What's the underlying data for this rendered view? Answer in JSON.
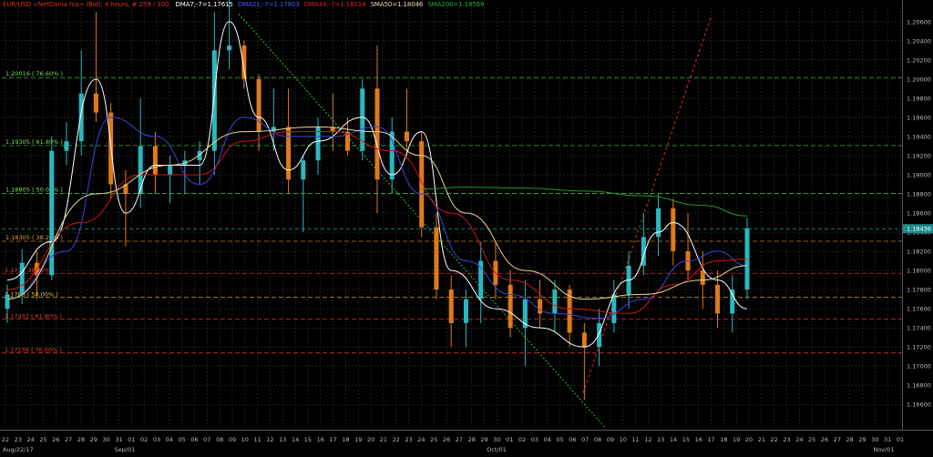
{
  "header": {
    "symbol": "EUR/USD <NetDania fxa> (Bid), 4 hours, # 259 / 300,",
    "dma7": "DMA7;-7=1.17615",
    "dma21": "DMA21;-7=1.17903",
    "dma34": "DMA34;-7=1.18114",
    "sma50": "SMA50=1.18046",
    "sma200": "SMA200=1.18569"
  },
  "colors": {
    "background": "#000000",
    "bull": "#2bb7c0",
    "bear": "#e07a17",
    "dma7": "#ffffff",
    "dma21": "#3a45d9",
    "dma34": "#d11414",
    "sma50": "#e8d49a",
    "sma200": "#1c9a2a",
    "fib_up": "#3fae3f",
    "fib_down": "#d42a2a",
    "fib_mid": "#c87818"
  },
  "chart_data": {
    "type": "candlestick",
    "title": "EUR/USD <NetDania fxa> (Bid), 4 hours",
    "ylim": [
      1.16336,
      1.2075
    ],
    "y_ticks": [
      1.206,
      1.204,
      1.202,
      1.2,
      1.198,
      1.196,
      1.194,
      1.192,
      1.19,
      1.188,
      1.186,
      1.184,
      1.182,
      1.18,
      1.178,
      1.176,
      1.174,
      1.172,
      1.17,
      1.168,
      1.166
    ],
    "y_tick_labels": [
      "1.20600",
      "1.20400",
      "1.20200",
      "1.20000",
      "1.19800",
      "1.19600",
      "1.19400",
      "1.19200",
      "1.19000",
      "1.18800",
      "1.18600",
      "1.18400",
      "1.18200",
      "1.18000",
      "1.17800",
      "1.17600",
      "1.17400",
      "1.17200",
      "1.17000",
      "1.16800",
      "1.16600"
    ],
    "last_price": "1.18436",
    "x_day_labels": [
      "22",
      "23",
      "24",
      "25",
      "26",
      "27",
      "28",
      "29",
      "30",
      "31",
      "01",
      "02",
      "03",
      "04",
      "05",
      "06",
      "07",
      "08",
      "09",
      "10",
      "11",
      "12",
      "13",
      "14",
      "15",
      "16",
      "17",
      "18",
      "19",
      "20",
      "21",
      "22",
      "23",
      "24",
      "25",
      "26",
      "27",
      "28",
      "29",
      "30",
      "01",
      "02",
      "03",
      "04",
      "05",
      "06",
      "07",
      "08",
      "09",
      "10",
      "11",
      "12",
      "13",
      "14",
      "15",
      "16",
      "17",
      "18",
      "19",
      "20",
      "21",
      "22",
      "23",
      "24",
      "25",
      "26",
      "27",
      "28",
      "29",
      "30",
      "31",
      "01"
    ],
    "x_month_labels": [
      "Aug/22/17",
      "Sep/01",
      "Oct/01",
      "Nov/01"
    ],
    "fib_levels_upper": [
      {
        "label": "1.20016 ( 76.60% )",
        "value": 1.20016
      },
      {
        "label": "1.19305 ( 61.80% )",
        "value": 1.19305
      },
      {
        "label": "1.18805 ( 50.00% )",
        "value": 1.18805
      },
      {
        "label": "1.18305 ( 38.20% )",
        "value": 1.18305
      }
    ],
    "fib_levels_lower": [
      {
        "label": "1.177 ( 38.20% )",
        "value": 1.1797
      },
      {
        "label": "1.1768 ( 50.00% )",
        "value": 1.1772
      },
      {
        "label": "1.17492 ( 61.80% )",
        "value": 1.17492
      },
      {
        "label": "1.17138 ( 76.60% )",
        "value": 1.17138
      }
    ],
    "extra_levels": [
      1.18436
    ],
    "trendlines": [
      {
        "name": "downtrend",
        "from": [
          "Aug 31",
          1.2068
        ],
        "to": [
          "Oct 09",
          1.1635
        ]
      },
      {
        "name": "projection",
        "from": [
          "Oct 06",
          1.167
        ],
        "to": [
          "Oct 19",
          1.206
        ]
      }
    ],
    "candles": [
      {
        "day": "Aug 22",
        "open": 1.176,
        "high": 1.1785,
        "low": 1.1745,
        "close": 1.1775
      },
      {
        "day": "Aug 23",
        "open": 1.1775,
        "high": 1.1822,
        "low": 1.1765,
        "close": 1.1808
      },
      {
        "day": "Aug 24",
        "open": 1.1808,
        "high": 1.182,
        "low": 1.177,
        "close": 1.1795
      },
      {
        "day": "Aug 25",
        "open": 1.1795,
        "high": 1.194,
        "low": 1.179,
        "close": 1.1925
      },
      {
        "day": "Aug 27",
        "open": 1.1925,
        "high": 1.1955,
        "low": 1.191,
        "close": 1.1935
      },
      {
        "day": "Aug 28",
        "open": 1.1935,
        "high": 1.203,
        "low": 1.192,
        "close": 1.1985
      },
      {
        "day": "Aug 29",
        "open": 1.1985,
        "high": 1.207,
        "low": 1.1955,
        "close": 1.1965
      },
      {
        "day": "Aug 30",
        "open": 1.1965,
        "high": 1.1975,
        "low": 1.1875,
        "close": 1.189
      },
      {
        "day": "Aug 31",
        "open": 1.189,
        "high": 1.1905,
        "low": 1.1825,
        "close": 1.188
      },
      {
        "day": "Sep 01",
        "open": 1.188,
        "high": 1.198,
        "low": 1.1865,
        "close": 1.193
      },
      {
        "day": "Sep 03",
        "open": 1.193,
        "high": 1.1945,
        "low": 1.188,
        "close": 1.19
      },
      {
        "day": "Sep 04",
        "open": 1.19,
        "high": 1.192,
        "low": 1.187,
        "close": 1.191
      },
      {
        "day": "Sep 05",
        "open": 1.191,
        "high": 1.1925,
        "low": 1.188,
        "close": 1.1915
      },
      {
        "day": "Sep 06",
        "open": 1.1915,
        "high": 1.1935,
        "low": 1.189,
        "close": 1.1925
      },
      {
        "day": "Sep 07",
        "open": 1.1925,
        "high": 1.207,
        "low": 1.19,
        "close": 1.203
      },
      {
        "day": "Sep 08",
        "open": 1.203,
        "high": 1.209,
        "low": 1.201,
        "close": 1.2035
      },
      {
        "day": "Sep 10",
        "open": 1.2035,
        "high": 1.204,
        "low": 1.199,
        "close": 1.2
      },
      {
        "day": "Sep 11",
        "open": 1.2,
        "high": 1.2005,
        "low": 1.1925,
        "close": 1.1945
      },
      {
        "day": "Sep 12",
        "open": 1.1945,
        "high": 1.199,
        "low": 1.1925,
        "close": 1.195
      },
      {
        "day": "Sep 13",
        "open": 1.195,
        "high": 1.199,
        "low": 1.188,
        "close": 1.1895
      },
      {
        "day": "Sep 14",
        "open": 1.1895,
        "high": 1.192,
        "low": 1.184,
        "close": 1.1915
      },
      {
        "day": "Sep 15",
        "open": 1.1915,
        "high": 1.196,
        "low": 1.19,
        "close": 1.195
      },
      {
        "day": "Sep 17",
        "open": 1.195,
        "high": 1.1985,
        "low": 1.1925,
        "close": 1.1945
      },
      {
        "day": "Sep 18",
        "open": 1.1945,
        "high": 1.196,
        "low": 1.192,
        "close": 1.1925
      },
      {
        "day": "Sep 19",
        "open": 1.1925,
        "high": 1.2,
        "low": 1.1915,
        "close": 1.199
      },
      {
        "day": "Sep 20",
        "open": 1.199,
        "high": 1.2035,
        "low": 1.186,
        "close": 1.1895
      },
      {
        "day": "Sep 21",
        "open": 1.1895,
        "high": 1.196,
        "low": 1.188,
        "close": 1.1945
      },
      {
        "day": "Sep 22",
        "open": 1.1945,
        "high": 1.199,
        "low": 1.192,
        "close": 1.1935
      },
      {
        "day": "Sep 24",
        "open": 1.1935,
        "high": 1.1945,
        "low": 1.1835,
        "close": 1.1845
      },
      {
        "day": "Sep 25",
        "open": 1.1845,
        "high": 1.186,
        "low": 1.177,
        "close": 1.178
      },
      {
        "day": "Sep 26",
        "open": 1.178,
        "high": 1.1795,
        "low": 1.172,
        "close": 1.1745
      },
      {
        "day": "Sep 27",
        "open": 1.1745,
        "high": 1.178,
        "low": 1.172,
        "close": 1.177
      },
      {
        "day": "Sep 28",
        "open": 1.177,
        "high": 1.183,
        "low": 1.1745,
        "close": 1.181
      },
      {
        "day": "Sep 29",
        "open": 1.181,
        "high": 1.183,
        "low": 1.177,
        "close": 1.1785
      },
      {
        "day": "Oct 01",
        "open": 1.1785,
        "high": 1.18,
        "low": 1.173,
        "close": 1.174
      },
      {
        "day": "Oct 02",
        "open": 1.174,
        "high": 1.179,
        "low": 1.17,
        "close": 1.177
      },
      {
        "day": "Oct 03",
        "open": 1.177,
        "high": 1.179,
        "low": 1.174,
        "close": 1.1755
      },
      {
        "day": "Oct 04",
        "open": 1.1755,
        "high": 1.179,
        "low": 1.1735,
        "close": 1.178
      },
      {
        "day": "Oct 05",
        "open": 1.178,
        "high": 1.1785,
        "low": 1.172,
        "close": 1.1735
      },
      {
        "day": "Oct 06",
        "open": 1.1735,
        "high": 1.1745,
        "low": 1.1665,
        "close": 1.172
      },
      {
        "day": "Oct 08",
        "open": 1.172,
        "high": 1.176,
        "low": 1.17,
        "close": 1.1745
      },
      {
        "day": "Oct 09",
        "open": 1.1745,
        "high": 1.179,
        "low": 1.1735,
        "close": 1.1775
      },
      {
        "day": "Oct 10",
        "open": 1.1775,
        "high": 1.182,
        "low": 1.176,
        "close": 1.1805
      },
      {
        "day": "Oct 11",
        "open": 1.1805,
        "high": 1.186,
        "low": 1.1795,
        "close": 1.1835
      },
      {
        "day": "Oct 12",
        "open": 1.1835,
        "high": 1.188,
        "low": 1.1815,
        "close": 1.1865
      },
      {
        "day": "Oct 13",
        "open": 1.1865,
        "high": 1.1875,
        "low": 1.1805,
        "close": 1.182
      },
      {
        "day": "Oct 15",
        "open": 1.182,
        "high": 1.186,
        "low": 1.179,
        "close": 1.18
      },
      {
        "day": "Oct 16",
        "open": 1.18,
        "high": 1.182,
        "low": 1.176,
        "close": 1.1785
      },
      {
        "day": "Oct 17",
        "open": 1.1785,
        "high": 1.18,
        "low": 1.174,
        "close": 1.1755
      },
      {
        "day": "Oct 18",
        "open": 1.1755,
        "high": 1.1795,
        "low": 1.1735,
        "close": 1.178
      },
      {
        "day": "Oct 19",
        "open": 1.178,
        "high": 1.1855,
        "low": 1.177,
        "close": 1.1844
      }
    ],
    "series": [
      {
        "name": "DMA7",
        "points": [
          [
            0,
            1.179
          ],
          [
            3,
            1.183
          ],
          [
            6,
            1.2
          ],
          [
            8,
            1.186
          ],
          [
            10,
            1.191
          ],
          [
            13,
            1.191
          ],
          [
            15,
            1.206
          ],
          [
            17,
            1.196
          ],
          [
            19,
            1.1905
          ],
          [
            21,
            1.1935
          ],
          [
            24,
            1.196
          ],
          [
            26,
            1.19
          ],
          [
            28,
            1.1945
          ],
          [
            30,
            1.18
          ],
          [
            33,
            1.176
          ],
          [
            36,
            1.174
          ],
          [
            39,
            1.172
          ],
          [
            42,
            1.179
          ],
          [
            44,
            1.184
          ],
          [
            45,
            1.185
          ],
          [
            48,
            1.179
          ],
          [
            50,
            1.176
          ]
        ]
      },
      {
        "name": "DMA21",
        "points": [
          [
            0,
            1.177
          ],
          [
            4,
            1.182
          ],
          [
            7,
            1.196
          ],
          [
            10,
            1.194
          ],
          [
            13,
            1.189
          ],
          [
            16,
            1.196
          ],
          [
            19,
            1.194
          ],
          [
            22,
            1.194
          ],
          [
            25,
            1.195
          ],
          [
            28,
            1.188
          ],
          [
            31,
            1.181
          ],
          [
            34,
            1.1775
          ],
          [
            37,
            1.1755
          ],
          [
            40,
            1.175
          ],
          [
            43,
            1.177
          ],
          [
            46,
            1.181
          ],
          [
            48,
            1.182
          ],
          [
            50,
            1.1805
          ]
        ]
      },
      {
        "name": "DMA34",
        "points": [
          [
            0,
            1.178
          ],
          [
            5,
            1.185
          ],
          [
            9,
            1.19
          ],
          [
            13,
            1.19
          ],
          [
            16,
            1.1935
          ],
          [
            19,
            1.1945
          ],
          [
            22,
            1.1945
          ],
          [
            26,
            1.1925
          ],
          [
            30,
            1.186
          ],
          [
            34,
            1.179
          ],
          [
            38,
            1.176
          ],
          [
            42,
            1.1755
          ],
          [
            45,
            1.1785
          ],
          [
            48,
            1.181
          ],
          [
            50,
            1.1812
          ]
        ]
      },
      {
        "name": "SMA50",
        "points": [
          [
            0,
            1.177
          ],
          [
            6,
            1.188
          ],
          [
            11,
            1.191
          ],
          [
            16,
            1.1945
          ],
          [
            21,
            1.195
          ],
          [
            25,
            1.1945
          ],
          [
            28,
            1.192
          ],
          [
            31,
            1.186
          ],
          [
            35,
            1.18
          ],
          [
            39,
            1.177
          ],
          [
            43,
            1.1775
          ],
          [
            47,
            1.179
          ],
          [
            50,
            1.1805
          ]
        ]
      },
      {
        "name": "SMA200",
        "points": [
          [
            28,
            1.1885
          ],
          [
            31,
            1.1887
          ],
          [
            35,
            1.1886
          ],
          [
            39,
            1.1883
          ],
          [
            43,
            1.1878
          ],
          [
            47,
            1.1868
          ],
          [
            50,
            1.1857
          ]
        ]
      }
    ]
  }
}
